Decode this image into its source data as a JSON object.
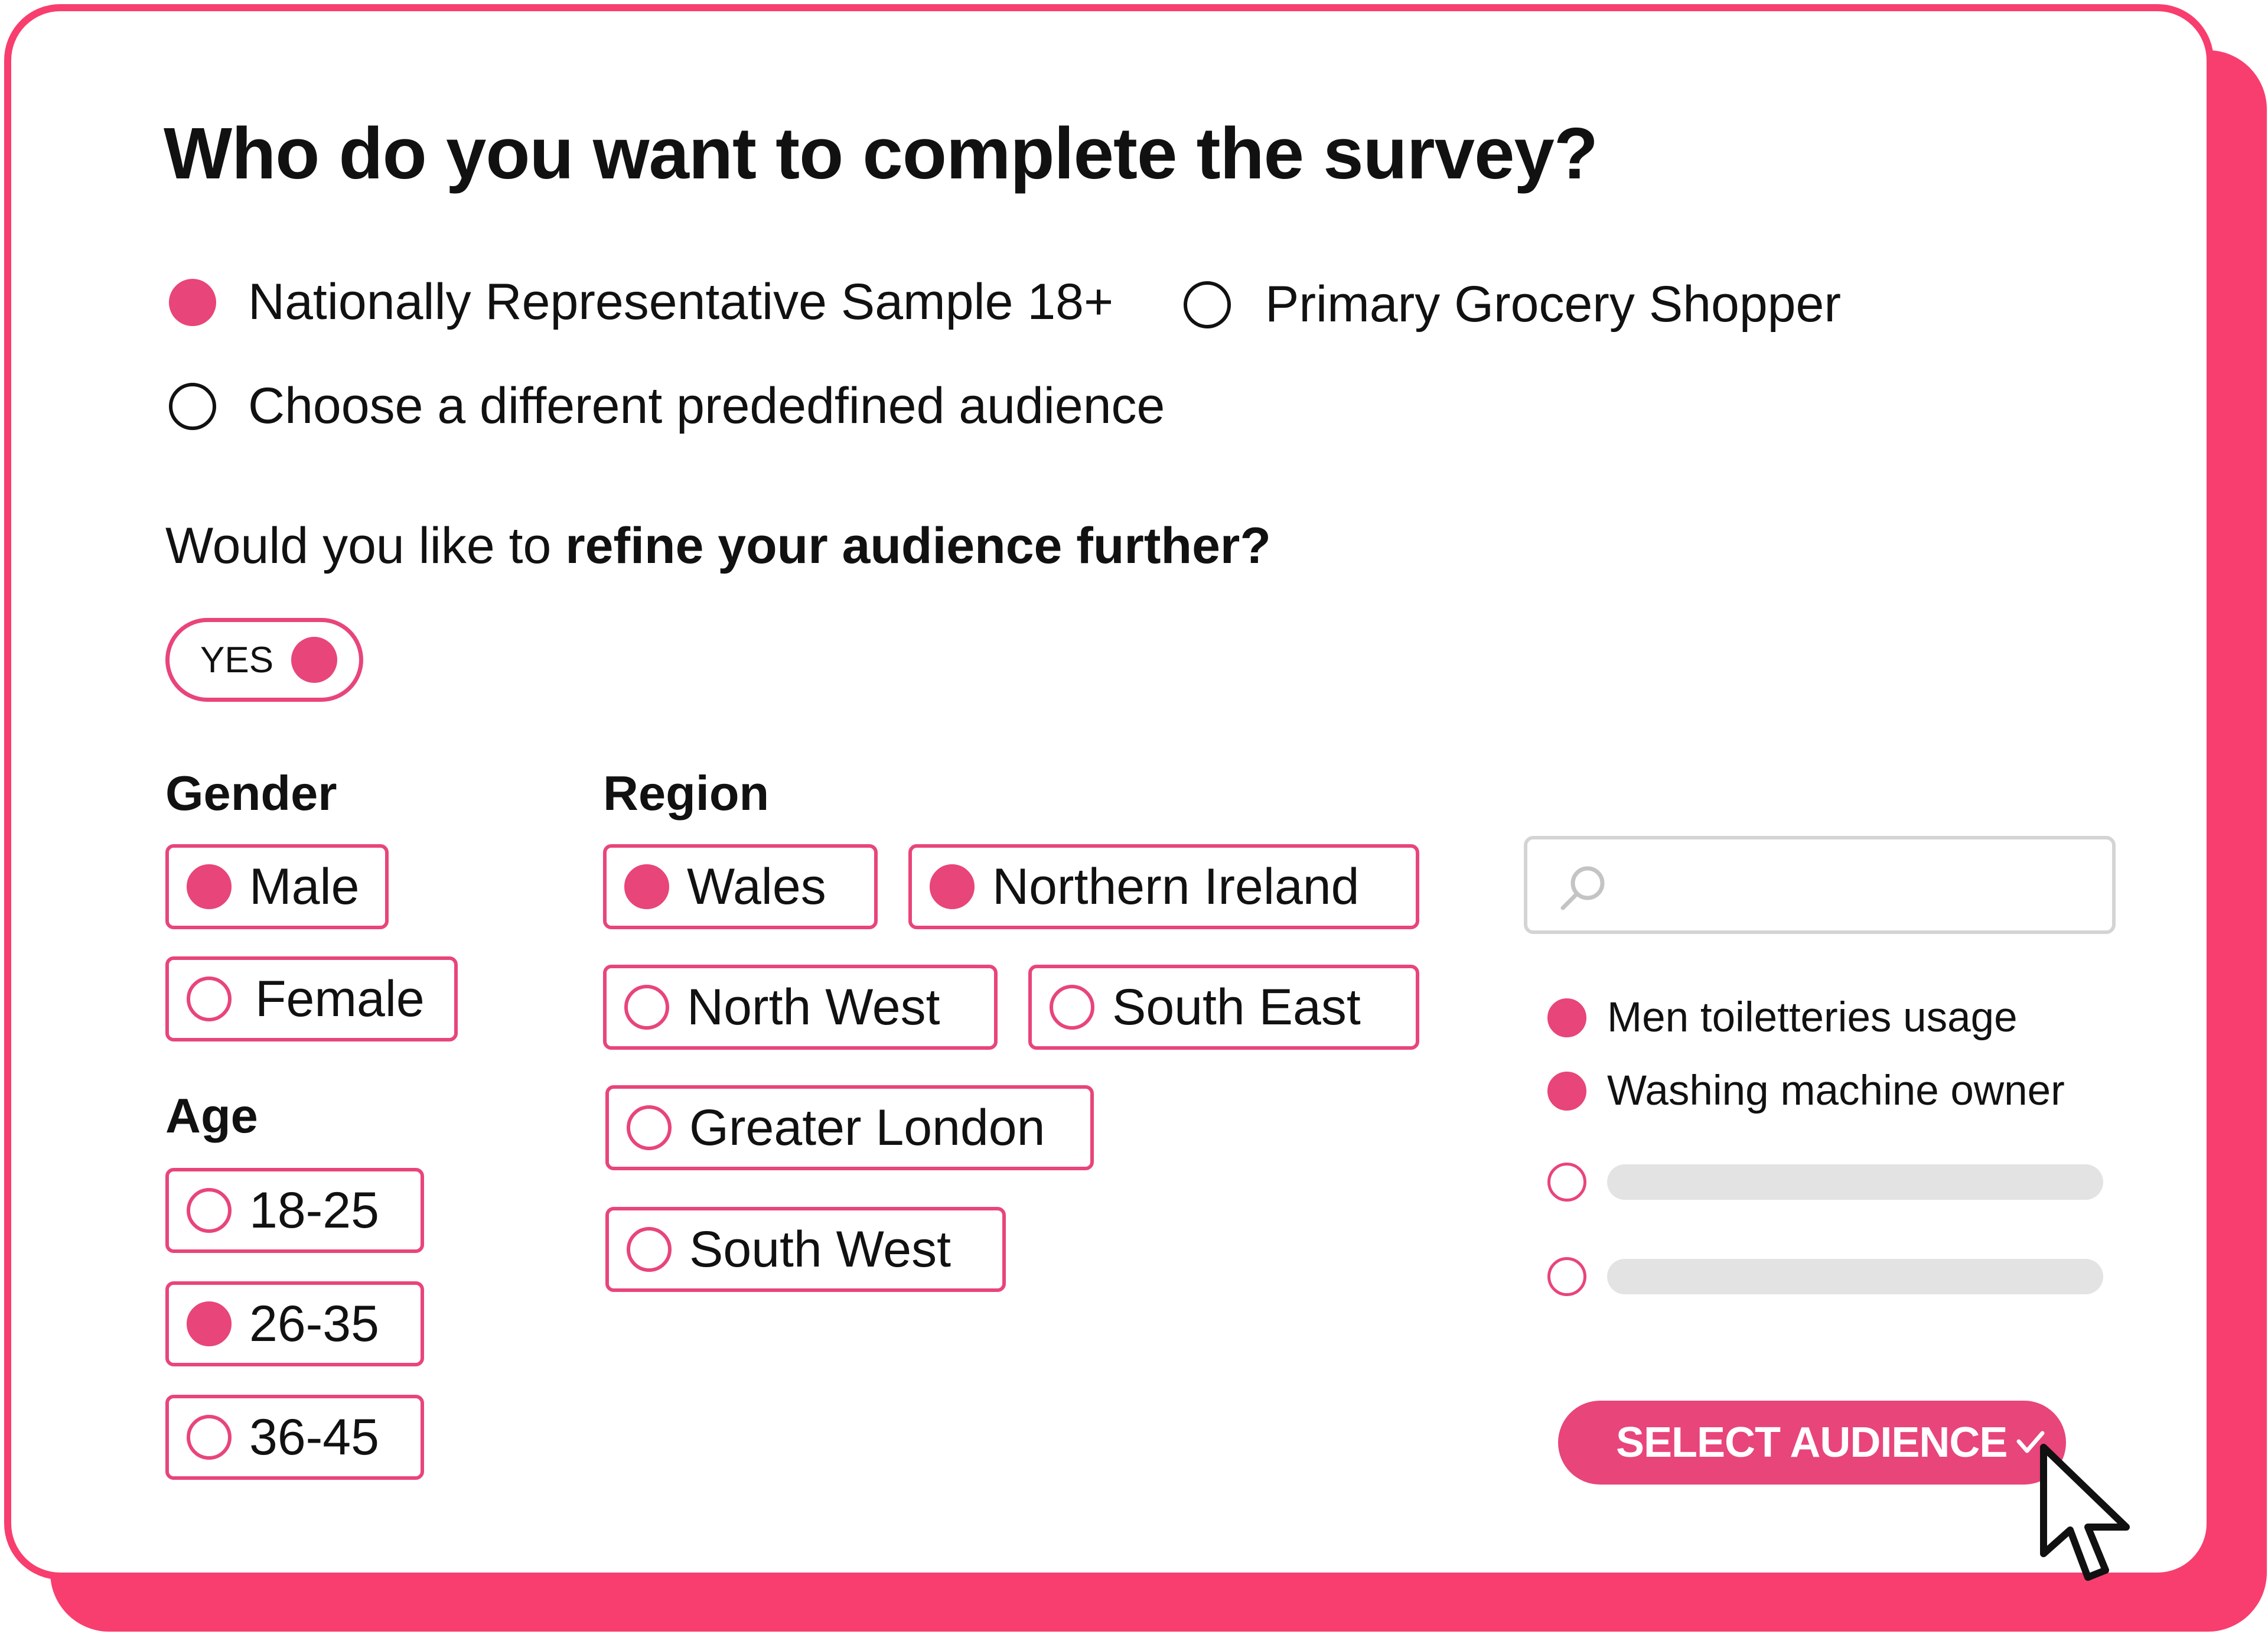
{
  "question": "Who do you want to complete the survey?",
  "audience_options": [
    {
      "label": "Nationally Representative Sample 18+",
      "selected": true
    },
    {
      "label": "Primary Grocery Shopper",
      "selected": false
    },
    {
      "label": "Choose a different prededfined audience",
      "selected": false
    }
  ],
  "refine": {
    "prefix": "Would you like to ",
    "emphasis": "refine your audience further?",
    "toggle_label": "YES",
    "toggle_on": true
  },
  "gender": {
    "label": "Gender",
    "options": [
      {
        "label": "Male",
        "selected": true
      },
      {
        "label": "Female",
        "selected": false
      }
    ]
  },
  "age": {
    "label": "Age",
    "options": [
      {
        "label": "18-25",
        "selected": false
      },
      {
        "label": "26-35",
        "selected": true
      },
      {
        "label": "36-45",
        "selected": false
      }
    ]
  },
  "region": {
    "label": "Region",
    "options": [
      {
        "label": "Wales",
        "selected": true
      },
      {
        "label": "Northern Ireland",
        "selected": true
      },
      {
        "label": "North West",
        "selected": false
      },
      {
        "label": "South East",
        "selected": false
      },
      {
        "label": "Greater London",
        "selected": false
      },
      {
        "label": "South West",
        "selected": false
      }
    ]
  },
  "search": {
    "placeholder": "",
    "icon": "search-icon"
  },
  "traits": [
    {
      "label": "Men toiletteries usage",
      "selected": true
    },
    {
      "label": "Washing machine owner",
      "selected": true
    }
  ],
  "cta_label": "SELECT AUDIENCE",
  "colors": {
    "accent": "#e8457a",
    "frame": "#f83e6e",
    "placeholder_bar": "#e3e3e3"
  }
}
